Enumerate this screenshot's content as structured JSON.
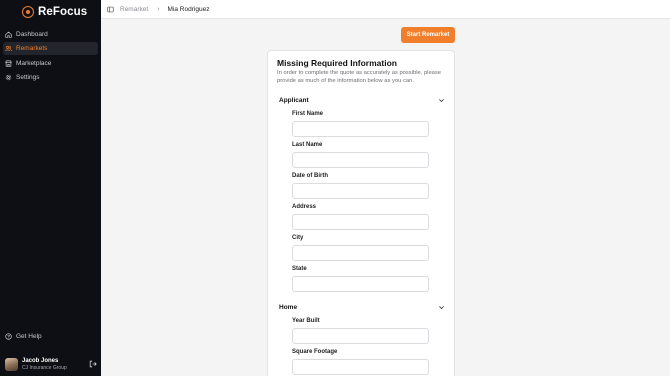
{
  "app": {
    "name": "ReFocus",
    "brand_color": "#f07e2a",
    "sidebar_bg": "#0d0f14"
  },
  "sidebar": {
    "items": [
      {
        "label": "Dashboard",
        "icon": "home-icon",
        "active": false
      },
      {
        "label": "Remarkets",
        "icon": "users-icon",
        "active": true
      },
      {
        "label": "Marketplace",
        "icon": "store-icon",
        "active": false
      },
      {
        "label": "Settings",
        "icon": "gear-icon",
        "active": false
      }
    ],
    "help_label": "Get Help",
    "user": {
      "name": "Jacob Jones",
      "org": "CJ Insurance Group"
    }
  },
  "breadcrumb": {
    "parent": "Remarket",
    "current": "Mia Rodriguez"
  },
  "actions": {
    "start_label": "Start Remarket"
  },
  "form": {
    "title": "Missing Required Information",
    "subtitle": "In order to complete the quote as accurately as possible, please provide as much of the information below as you can.",
    "sections": [
      {
        "label": "Applicant",
        "fields": [
          {
            "label": "First Name",
            "value": ""
          },
          {
            "label": "Last Name",
            "value": ""
          },
          {
            "label": "Date of Birth",
            "value": ""
          },
          {
            "label": "Address",
            "value": ""
          },
          {
            "label": "City",
            "value": ""
          },
          {
            "label": "State",
            "value": ""
          }
        ]
      },
      {
        "label": "Home",
        "fields": [
          {
            "label": "Year Built",
            "value": ""
          },
          {
            "label": "Square Footage",
            "value": ""
          }
        ]
      }
    ]
  }
}
